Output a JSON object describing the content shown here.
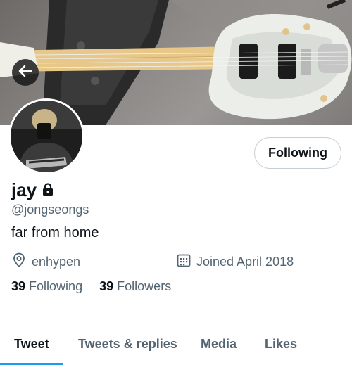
{
  "profile": {
    "name": "jay",
    "handle": "@jongseongs",
    "bio": "far from home",
    "location": "enhypen",
    "joined": "Joined April 2018",
    "following_count": "39",
    "following_label": "Following",
    "followers_count": "39",
    "followers_label": "Followers"
  },
  "actions": {
    "follow_button": "Following"
  },
  "tabs": [
    {
      "label": "Tweet",
      "active": true
    },
    {
      "label": "Tweets & replies",
      "active": false
    },
    {
      "label": "Media",
      "active": false
    },
    {
      "label": "Likes",
      "active": false
    }
  ],
  "colors": {
    "accent": "#1d9bf0",
    "text_primary": "#0f1419",
    "text_secondary": "#536471"
  },
  "icons": {
    "back": "arrow-left-icon",
    "lock": "lock-icon",
    "location": "location-pin-icon",
    "calendar": "calendar-icon"
  }
}
